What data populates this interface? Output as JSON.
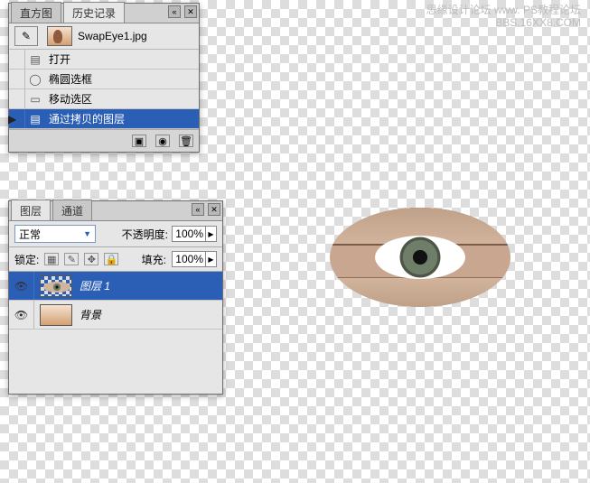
{
  "watermark": {
    "line1": "思缘设计论坛  www.  PS教程论坛",
    "line2": "BBS.16XX8.COM"
  },
  "history": {
    "tabs": {
      "histogram": "直方图",
      "history": "历史记录"
    },
    "document": "SwapEye1.jpg",
    "items": [
      {
        "icon": "open-icon",
        "glyph": "▤",
        "label": "打开",
        "selected": false
      },
      {
        "icon": "ellipse-marquee-icon",
        "glyph": "◯",
        "label": "椭圆选框",
        "selected": false
      },
      {
        "icon": "move-selection-icon",
        "glyph": "▭",
        "label": "移动选区",
        "selected": false
      },
      {
        "icon": "layer-via-copy-icon",
        "glyph": "▤",
        "label": "通过拷贝的图层",
        "selected": true
      }
    ]
  },
  "layers": {
    "tabs": {
      "layers": "图层",
      "channels": "通道"
    },
    "blend_mode": "正常",
    "opacity_label": "不透明度:",
    "opacity_value": "100%",
    "lock_label": "锁定:",
    "fill_label": "填充:",
    "fill_value": "100%",
    "items": [
      {
        "name": "图层 1",
        "visible": true,
        "selected": true,
        "thumb": "eye"
      },
      {
        "name": "背景",
        "visible": true,
        "selected": false,
        "thumb": "bg"
      }
    ]
  }
}
